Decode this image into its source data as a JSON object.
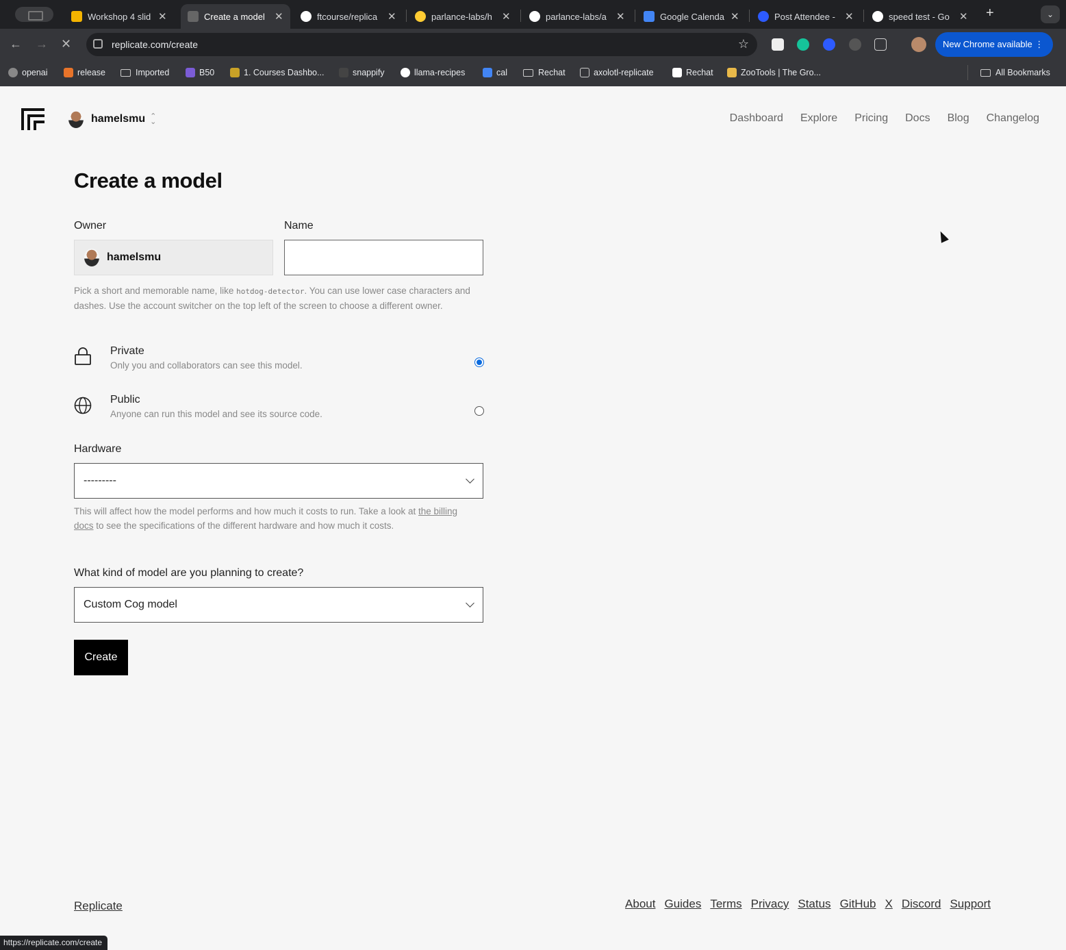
{
  "browser": {
    "tabs": [
      {
        "title": "Workshop 4 slid",
        "favicon_color": "#f4b400",
        "active": false
      },
      {
        "title": "Create a model",
        "favicon_color": "#666666",
        "active": true
      },
      {
        "title": "ftcourse/replica",
        "favicon_color": "#ffffff",
        "active": false
      },
      {
        "title": "parlance-labs/h",
        "favicon_color": "#ffcc33",
        "active": false
      },
      {
        "title": "parlance-labs/a",
        "favicon_color": "#ffffff",
        "active": false
      },
      {
        "title": "Google Calenda",
        "favicon_color": "#4285f4",
        "active": false
      },
      {
        "title": "Post Attendee -",
        "favicon_color": "#2d5bff",
        "active": false
      },
      {
        "title": "speed test - Go",
        "favicon_color": "#ffffff",
        "active": false
      }
    ],
    "url": "replicate.com/create",
    "update_button": "New Chrome available",
    "bookmarks": [
      {
        "label": "openai",
        "icon": "openai-icon"
      },
      {
        "label": "release",
        "icon": "release-icon"
      },
      {
        "label": "Imported",
        "icon": "folder-icon"
      },
      {
        "label": "B50",
        "icon": "b50-icon"
      },
      {
        "label": "1. Courses Dashbo...",
        "icon": "courses-icon"
      },
      {
        "label": "snappify",
        "icon": "snappify-icon"
      },
      {
        "label": "llama-recipes",
        "icon": "github-icon"
      },
      {
        "label": "cal",
        "icon": "calendar-icon"
      },
      {
        "label": "Rechat",
        "icon": "folder-icon"
      },
      {
        "label": "axolotl-replicate",
        "icon": "replicate-icon"
      },
      {
        "label": "Rechat",
        "icon": "rechat-icon"
      },
      {
        "label": "ZooTools | The Gro...",
        "icon": "zootools-icon"
      }
    ],
    "all_bookmarks": "All Bookmarks",
    "status_url": "https://replicate.com/create"
  },
  "header": {
    "account_name": "hamelsmu",
    "nav": [
      "Dashboard",
      "Explore",
      "Pricing",
      "Docs",
      "Blog",
      "Changelog"
    ]
  },
  "form": {
    "title": "Create a model",
    "owner_label": "Owner",
    "owner_value": "hamelsmu",
    "name_label": "Name",
    "name_value": "",
    "name_help_pre": "Pick a short and memorable name, like ",
    "name_help_code": "hotdog-detector",
    "name_help_post": ". You can use lower case characters and dashes. Use the account switcher on the top left of the screen to choose a different owner.",
    "visibility": [
      {
        "title": "Private",
        "desc": "Only you and collaborators can see this model.",
        "icon": "lock-icon",
        "selected": true
      },
      {
        "title": "Public",
        "desc": "Anyone can run this model and see its source code.",
        "icon": "globe-icon",
        "selected": false
      }
    ],
    "hardware_label": "Hardware",
    "hardware_value": "---------",
    "hardware_help_pre": "This will affect how the model performs and how much it costs to run. Take a look at ",
    "hardware_help_link": "the billing docs",
    "hardware_help_post": " to see the specifications of the different hardware and how much it costs.",
    "model_kind_label": "What kind of model are you planning to create?",
    "model_kind_value": "Custom Cog model",
    "submit_label": "Create"
  },
  "footer": {
    "brand": "Replicate",
    "links": [
      "About",
      "Guides",
      "Terms",
      "Privacy",
      "Status",
      "GitHub",
      "X",
      "Discord",
      "Support"
    ]
  },
  "colors": {
    "accent_radio": "#0b6bde",
    "chrome_update_button": "#0b57d0",
    "page_background": "#f6f6f6"
  }
}
